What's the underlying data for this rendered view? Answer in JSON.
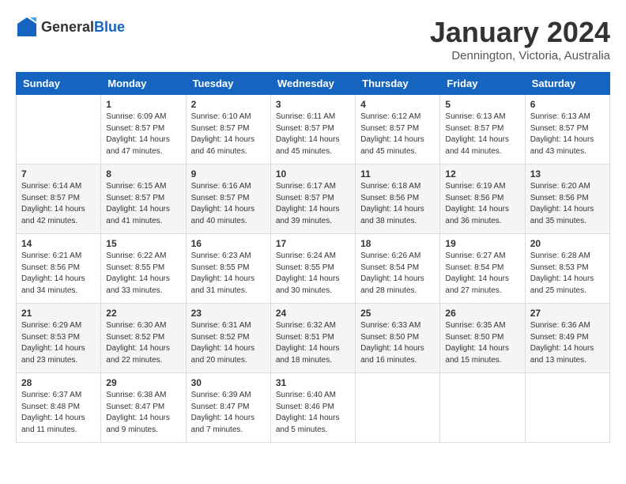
{
  "header": {
    "logo_general": "General",
    "logo_blue": "Blue",
    "month_title": "January 2024",
    "location": "Dennington, Victoria, Australia"
  },
  "weekdays": [
    "Sunday",
    "Monday",
    "Tuesday",
    "Wednesday",
    "Thursday",
    "Friday",
    "Saturday"
  ],
  "weeks": [
    [
      {
        "day": "",
        "sunrise": "",
        "sunset": "",
        "daylight": ""
      },
      {
        "day": "1",
        "sunrise": "Sunrise: 6:09 AM",
        "sunset": "Sunset: 8:57 PM",
        "daylight": "Daylight: 14 hours and 47 minutes."
      },
      {
        "day": "2",
        "sunrise": "Sunrise: 6:10 AM",
        "sunset": "Sunset: 8:57 PM",
        "daylight": "Daylight: 14 hours and 46 minutes."
      },
      {
        "day": "3",
        "sunrise": "Sunrise: 6:11 AM",
        "sunset": "Sunset: 8:57 PM",
        "daylight": "Daylight: 14 hours and 45 minutes."
      },
      {
        "day": "4",
        "sunrise": "Sunrise: 6:12 AM",
        "sunset": "Sunset: 8:57 PM",
        "daylight": "Daylight: 14 hours and 45 minutes."
      },
      {
        "day": "5",
        "sunrise": "Sunrise: 6:13 AM",
        "sunset": "Sunset: 8:57 PM",
        "daylight": "Daylight: 14 hours and 44 minutes."
      },
      {
        "day": "6",
        "sunrise": "Sunrise: 6:13 AM",
        "sunset": "Sunset: 8:57 PM",
        "daylight": "Daylight: 14 hours and 43 minutes."
      }
    ],
    [
      {
        "day": "7",
        "sunrise": "Sunrise: 6:14 AM",
        "sunset": "Sunset: 8:57 PM",
        "daylight": "Daylight: 14 hours and 42 minutes."
      },
      {
        "day": "8",
        "sunrise": "Sunrise: 6:15 AM",
        "sunset": "Sunset: 8:57 PM",
        "daylight": "Daylight: 14 hours and 41 minutes."
      },
      {
        "day": "9",
        "sunrise": "Sunrise: 6:16 AM",
        "sunset": "Sunset: 8:57 PM",
        "daylight": "Daylight: 14 hours and 40 minutes."
      },
      {
        "day": "10",
        "sunrise": "Sunrise: 6:17 AM",
        "sunset": "Sunset: 8:57 PM",
        "daylight": "Daylight: 14 hours and 39 minutes."
      },
      {
        "day": "11",
        "sunrise": "Sunrise: 6:18 AM",
        "sunset": "Sunset: 8:56 PM",
        "daylight": "Daylight: 14 hours and 38 minutes."
      },
      {
        "day": "12",
        "sunrise": "Sunrise: 6:19 AM",
        "sunset": "Sunset: 8:56 PM",
        "daylight": "Daylight: 14 hours and 36 minutes."
      },
      {
        "day": "13",
        "sunrise": "Sunrise: 6:20 AM",
        "sunset": "Sunset: 8:56 PM",
        "daylight": "Daylight: 14 hours and 35 minutes."
      }
    ],
    [
      {
        "day": "14",
        "sunrise": "Sunrise: 6:21 AM",
        "sunset": "Sunset: 8:56 PM",
        "daylight": "Daylight: 14 hours and 34 minutes."
      },
      {
        "day": "15",
        "sunrise": "Sunrise: 6:22 AM",
        "sunset": "Sunset: 8:55 PM",
        "daylight": "Daylight: 14 hours and 33 minutes."
      },
      {
        "day": "16",
        "sunrise": "Sunrise: 6:23 AM",
        "sunset": "Sunset: 8:55 PM",
        "daylight": "Daylight: 14 hours and 31 minutes."
      },
      {
        "day": "17",
        "sunrise": "Sunrise: 6:24 AM",
        "sunset": "Sunset: 8:55 PM",
        "daylight": "Daylight: 14 hours and 30 minutes."
      },
      {
        "day": "18",
        "sunrise": "Sunrise: 6:26 AM",
        "sunset": "Sunset: 8:54 PM",
        "daylight": "Daylight: 14 hours and 28 minutes."
      },
      {
        "day": "19",
        "sunrise": "Sunrise: 6:27 AM",
        "sunset": "Sunset: 8:54 PM",
        "daylight": "Daylight: 14 hours and 27 minutes."
      },
      {
        "day": "20",
        "sunrise": "Sunrise: 6:28 AM",
        "sunset": "Sunset: 8:53 PM",
        "daylight": "Daylight: 14 hours and 25 minutes."
      }
    ],
    [
      {
        "day": "21",
        "sunrise": "Sunrise: 6:29 AM",
        "sunset": "Sunset: 8:53 PM",
        "daylight": "Daylight: 14 hours and 23 minutes."
      },
      {
        "day": "22",
        "sunrise": "Sunrise: 6:30 AM",
        "sunset": "Sunset: 8:52 PM",
        "daylight": "Daylight: 14 hours and 22 minutes."
      },
      {
        "day": "23",
        "sunrise": "Sunrise: 6:31 AM",
        "sunset": "Sunset: 8:52 PM",
        "daylight": "Daylight: 14 hours and 20 minutes."
      },
      {
        "day": "24",
        "sunrise": "Sunrise: 6:32 AM",
        "sunset": "Sunset: 8:51 PM",
        "daylight": "Daylight: 14 hours and 18 minutes."
      },
      {
        "day": "25",
        "sunrise": "Sunrise: 6:33 AM",
        "sunset": "Sunset: 8:50 PM",
        "daylight": "Daylight: 14 hours and 16 minutes."
      },
      {
        "day": "26",
        "sunrise": "Sunrise: 6:35 AM",
        "sunset": "Sunset: 8:50 PM",
        "daylight": "Daylight: 14 hours and 15 minutes."
      },
      {
        "day": "27",
        "sunrise": "Sunrise: 6:36 AM",
        "sunset": "Sunset: 8:49 PM",
        "daylight": "Daylight: 14 hours and 13 minutes."
      }
    ],
    [
      {
        "day": "28",
        "sunrise": "Sunrise: 6:37 AM",
        "sunset": "Sunset: 8:48 PM",
        "daylight": "Daylight: 14 hours and 11 minutes."
      },
      {
        "day": "29",
        "sunrise": "Sunrise: 6:38 AM",
        "sunset": "Sunset: 8:47 PM",
        "daylight": "Daylight: 14 hours and 9 minutes."
      },
      {
        "day": "30",
        "sunrise": "Sunrise: 6:39 AM",
        "sunset": "Sunset: 8:47 PM",
        "daylight": "Daylight: 14 hours and 7 minutes."
      },
      {
        "day": "31",
        "sunrise": "Sunrise: 6:40 AM",
        "sunset": "Sunset: 8:46 PM",
        "daylight": "Daylight: 14 hours and 5 minutes."
      },
      {
        "day": "",
        "sunrise": "",
        "sunset": "",
        "daylight": ""
      },
      {
        "day": "",
        "sunrise": "",
        "sunset": "",
        "daylight": ""
      },
      {
        "day": "",
        "sunrise": "",
        "sunset": "",
        "daylight": ""
      }
    ]
  ]
}
